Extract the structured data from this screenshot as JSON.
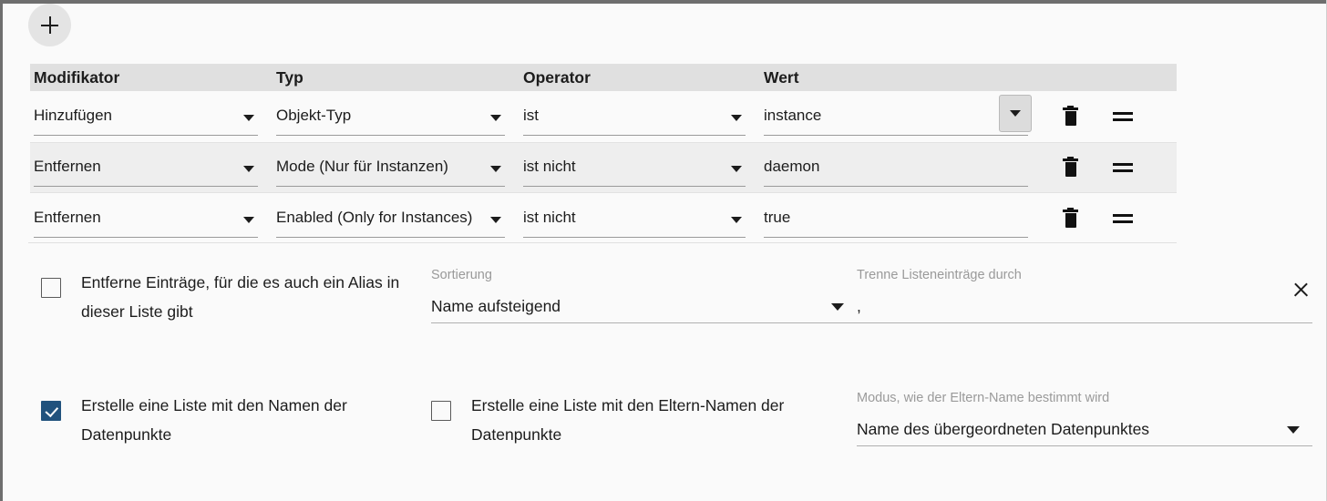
{
  "toolbar": {
    "add_label": "+"
  },
  "table": {
    "columns": [
      "Modifikator",
      "Typ",
      "Operator",
      "Wert",
      ""
    ],
    "rows": [
      {
        "modifier": "Hinzufügen",
        "type": "Objekt-Typ",
        "operator": "ist",
        "value": "instance"
      },
      {
        "modifier": "Entfernen",
        "type": "Mode (Nur für Instanzen)",
        "operator": "ist nicht",
        "value": "daemon"
      },
      {
        "modifier": "Entfernen",
        "type": "Enabled (Only for Instances)",
        "operator": "ist nicht",
        "value": "true"
      }
    ]
  },
  "options": {
    "remove_alias": {
      "label": "Entferne Einträge, für die es auch ein Alias in dieser Liste gibt",
      "checked": false
    },
    "sorting": {
      "label": "Sortierung",
      "value": "Name aufsteigend"
    },
    "separator": {
      "label": "Trenne Listeneinträge durch",
      "value": ","
    },
    "create_name_list": {
      "label": "Erstelle eine Liste mit den Namen der Datenpunkte",
      "checked": true
    },
    "create_parent_list": {
      "label": "Erstelle eine Liste mit den Eltern-Namen der Datenpunkte",
      "checked": false
    },
    "parent_mode": {
      "label": "Modus, wie der Eltern-Name bestimmt wird",
      "value": "Name des übergeordneten Datenpunktes"
    }
  },
  "colors": {
    "accent": "#21527d",
    "header_bg": "#e0e0e0",
    "row_alt_bg": "#eeeeee",
    "page_bg": "#fafafa"
  }
}
